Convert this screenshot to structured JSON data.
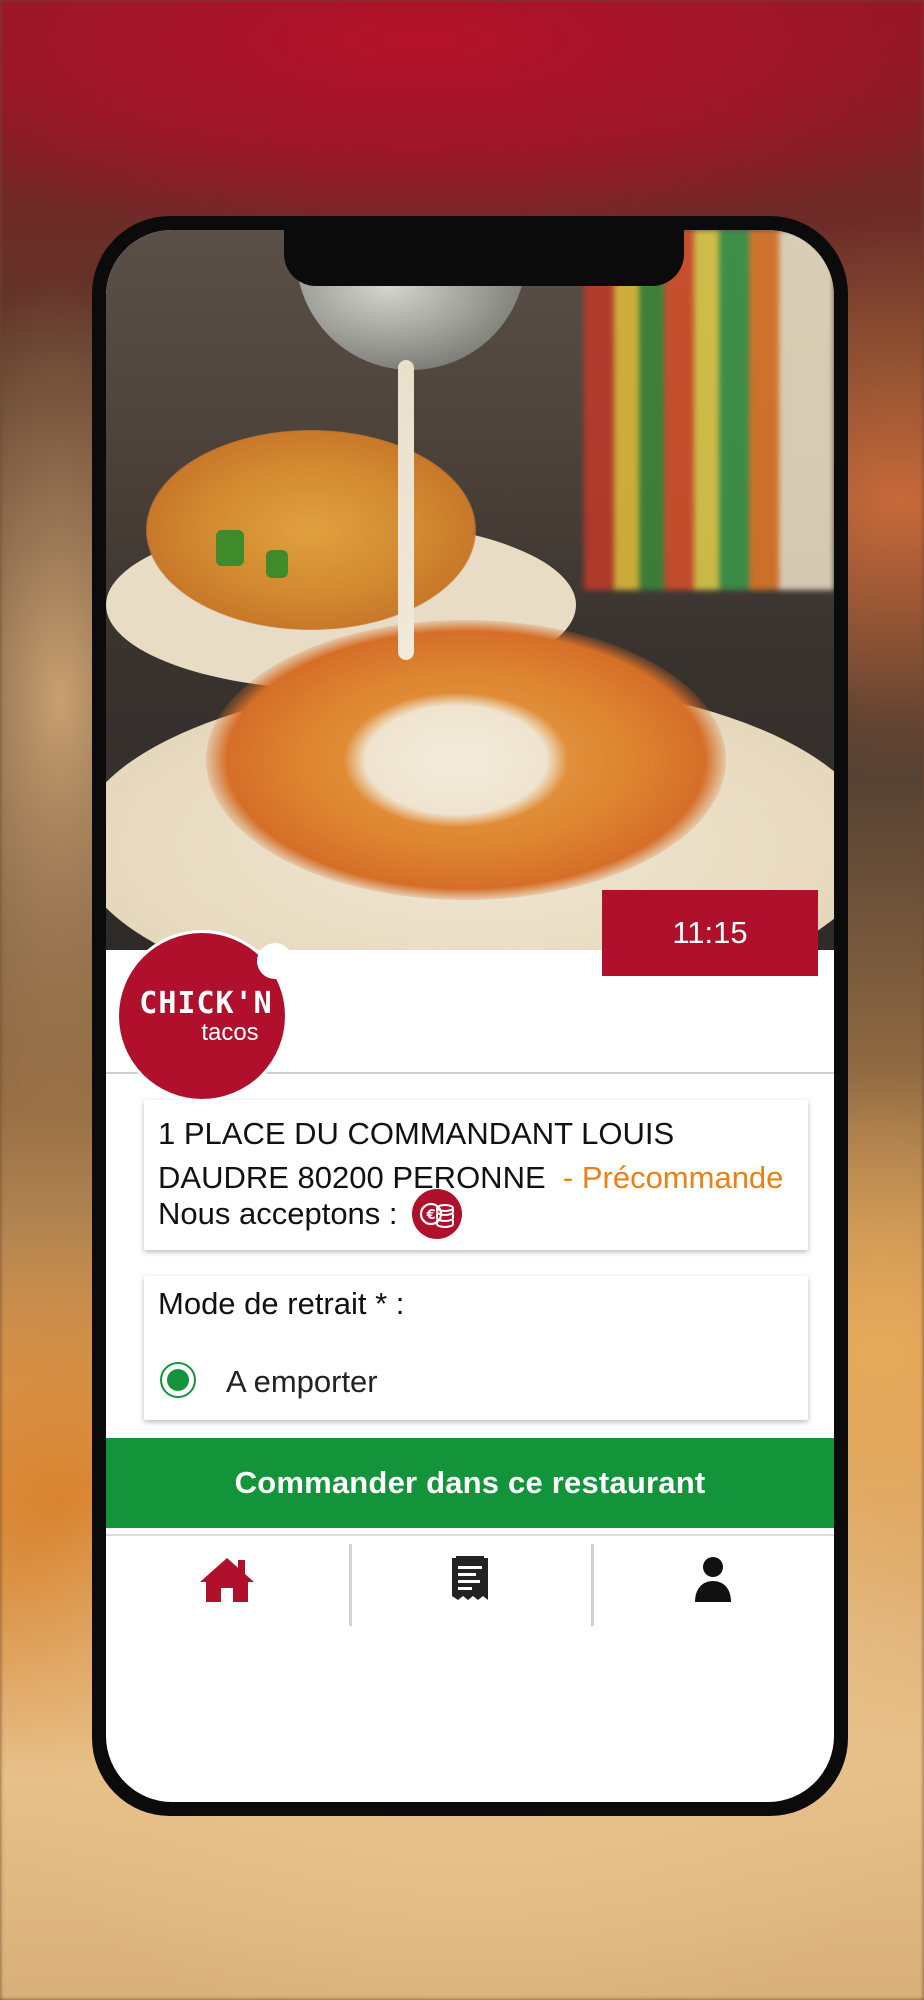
{
  "status_bar": {
    "time": "11:15"
  },
  "restaurant": {
    "logo": {
      "line1": "CHICK'N",
      "line2": "tacos"
    },
    "address": "1 PLACE DU COMMANDANT LOUIS DAUDRE 80200 PERONNE",
    "order_mode_status": "- Précommande",
    "payment_label": "Nous acceptons :",
    "payment_icon": "cash-coins-icon"
  },
  "pickup": {
    "label": "Mode de retrait * :",
    "options": [
      {
        "label": "A emporter",
        "selected": true
      }
    ]
  },
  "cta": {
    "label": "Commander dans ce restaurant"
  },
  "tabbar": {
    "items": [
      {
        "icon": "home-icon",
        "active": true
      },
      {
        "icon": "receipt-icon",
        "active": false
      },
      {
        "icon": "user-icon",
        "active": false
      }
    ]
  },
  "colors": {
    "brand_red": "#b0102c",
    "accent_green": "#13943a",
    "status_orange": "#ee7f10"
  }
}
